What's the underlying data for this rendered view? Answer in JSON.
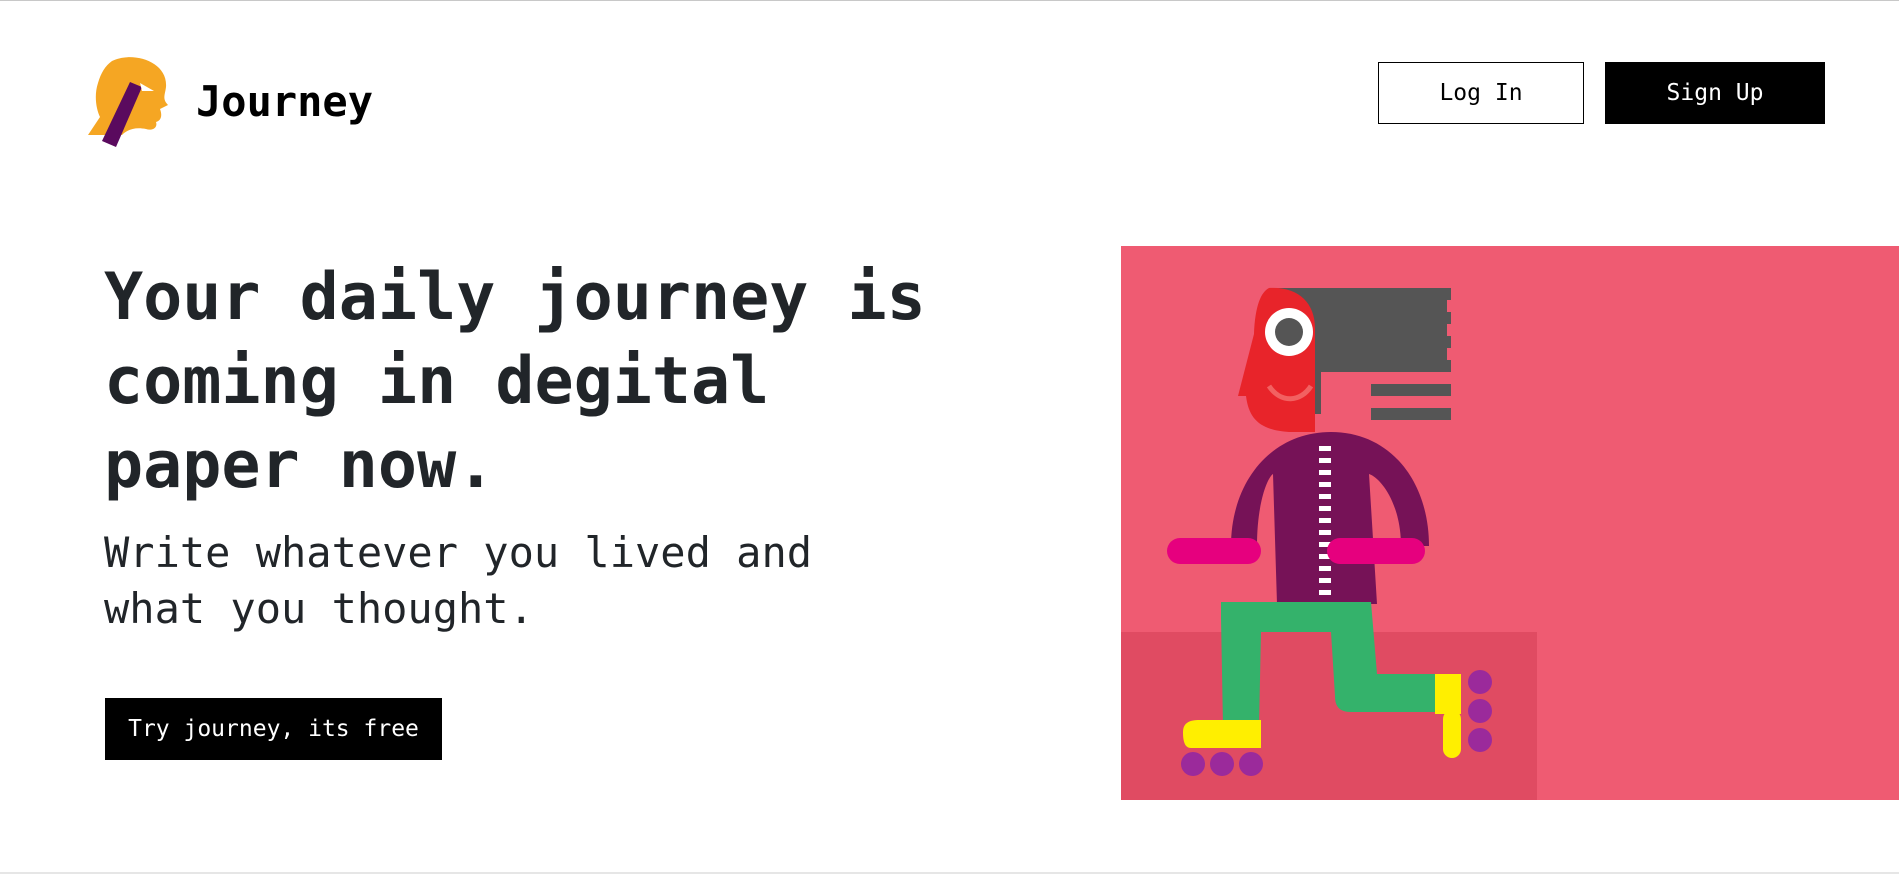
{
  "brand": {
    "name": "Journey",
    "logo_icon": "journey-head-logo",
    "logo_colors": [
      "#f5a623",
      "#5a0a5e"
    ]
  },
  "nav": {
    "login_label": "Log In",
    "signup_label": "Sign Up"
  },
  "hero": {
    "title": "Your daily journey is coming in degital paper now.",
    "subtitle": "Write whatever you lived and what you thought.",
    "cta_label": "Try journey, its free"
  },
  "illustration": {
    "icon": "roller-skater-illustration",
    "background_color": "#ef5b72",
    "floor_color": "#e04b62"
  }
}
